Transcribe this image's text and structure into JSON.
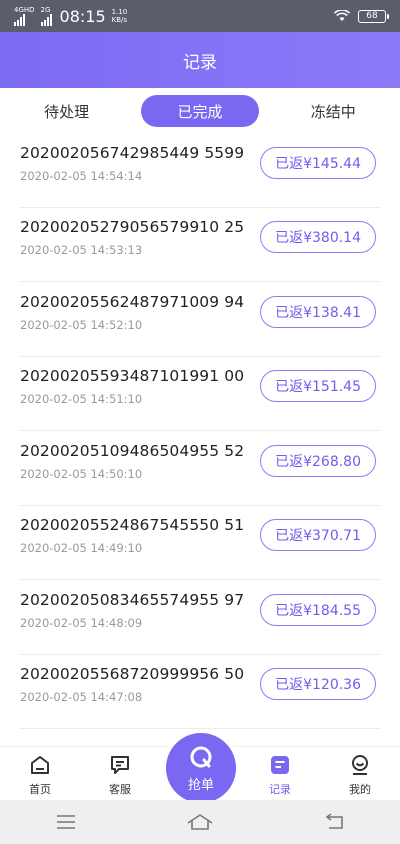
{
  "status_bar": {
    "net1": "4GHD",
    "net2": "2G",
    "time": "08:15",
    "speed_value": "1.10",
    "speed_unit": "KB/s",
    "battery": "68"
  },
  "header": {
    "title": "记录"
  },
  "tabs": [
    {
      "label": "待处理",
      "active": false
    },
    {
      "label": "已完成",
      "active": true
    },
    {
      "label": "冻结中",
      "active": false
    }
  ],
  "records": [
    {
      "order_no": "202002056742985449 5599",
      "time": "2020-02-05 14:54:14",
      "amount": "已返¥145.44"
    },
    {
      "order_no": "20200205279056579910 25",
      "time": "2020-02-05 14:53:13",
      "amount": "已返¥380.14"
    },
    {
      "order_no": "20200205562487971009 94",
      "time": "2020-02-05 14:52:10",
      "amount": "已返¥138.41"
    },
    {
      "order_no": "20200205593487101991 00",
      "time": "2020-02-05 14:51:10",
      "amount": "已返¥151.45"
    },
    {
      "order_no": "20200205109486504955 52",
      "time": "2020-02-05 14:50:10",
      "amount": "已返¥268.80"
    },
    {
      "order_no": "20200205524867545550 51",
      "time": "2020-02-05 14:49:10",
      "amount": "已返¥370.71"
    },
    {
      "order_no": "20200205083465574955 97",
      "time": "2020-02-05 14:48:09",
      "amount": "已返¥184.55"
    },
    {
      "order_no": "20200205568720999956 50",
      "time": "2020-02-05 14:47:08",
      "amount": "已返¥120.36"
    }
  ],
  "bottom_nav": {
    "home": "首页",
    "service": "客服",
    "grab": "抢单",
    "records": "记录",
    "mine": "我的"
  },
  "colors": {
    "accent": "#7b68f2",
    "header_gradient_start": "#7d6cf4",
    "header_gradient_end": "#8a79f7",
    "text_dark": "#222222",
    "text_muted": "#9a9a9a"
  }
}
